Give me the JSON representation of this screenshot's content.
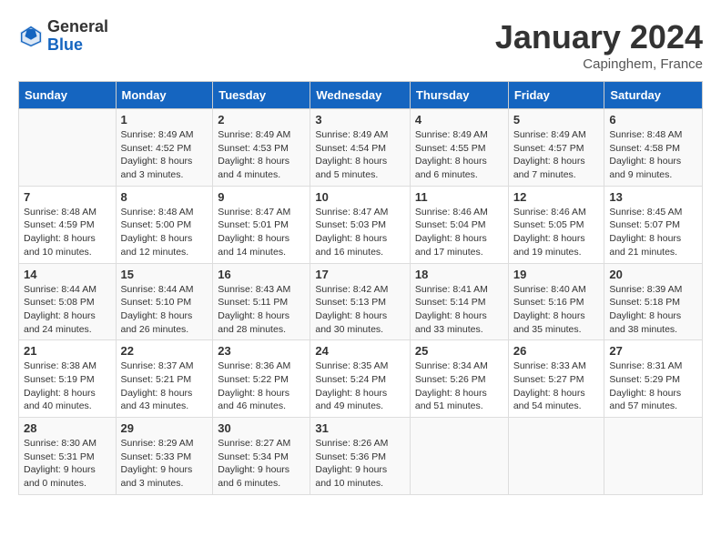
{
  "header": {
    "logo_general": "General",
    "logo_blue": "Blue",
    "month_title": "January 2024",
    "location": "Capinghem, France"
  },
  "days_of_week": [
    "Sunday",
    "Monday",
    "Tuesday",
    "Wednesday",
    "Thursday",
    "Friday",
    "Saturday"
  ],
  "weeks": [
    [
      {
        "day": "",
        "sunrise": "",
        "sunset": "",
        "daylight": ""
      },
      {
        "day": "1",
        "sunrise": "Sunrise: 8:49 AM",
        "sunset": "Sunset: 4:52 PM",
        "daylight": "Daylight: 8 hours and 3 minutes."
      },
      {
        "day": "2",
        "sunrise": "Sunrise: 8:49 AM",
        "sunset": "Sunset: 4:53 PM",
        "daylight": "Daylight: 8 hours and 4 minutes."
      },
      {
        "day": "3",
        "sunrise": "Sunrise: 8:49 AM",
        "sunset": "Sunset: 4:54 PM",
        "daylight": "Daylight: 8 hours and 5 minutes."
      },
      {
        "day": "4",
        "sunrise": "Sunrise: 8:49 AM",
        "sunset": "Sunset: 4:55 PM",
        "daylight": "Daylight: 8 hours and 6 minutes."
      },
      {
        "day": "5",
        "sunrise": "Sunrise: 8:49 AM",
        "sunset": "Sunset: 4:57 PM",
        "daylight": "Daylight: 8 hours and 7 minutes."
      },
      {
        "day": "6",
        "sunrise": "Sunrise: 8:48 AM",
        "sunset": "Sunset: 4:58 PM",
        "daylight": "Daylight: 8 hours and 9 minutes."
      }
    ],
    [
      {
        "day": "7",
        "sunrise": "Sunrise: 8:48 AM",
        "sunset": "Sunset: 4:59 PM",
        "daylight": "Daylight: 8 hours and 10 minutes."
      },
      {
        "day": "8",
        "sunrise": "Sunrise: 8:48 AM",
        "sunset": "Sunset: 5:00 PM",
        "daylight": "Daylight: 8 hours and 12 minutes."
      },
      {
        "day": "9",
        "sunrise": "Sunrise: 8:47 AM",
        "sunset": "Sunset: 5:01 PM",
        "daylight": "Daylight: 8 hours and 14 minutes."
      },
      {
        "day": "10",
        "sunrise": "Sunrise: 8:47 AM",
        "sunset": "Sunset: 5:03 PM",
        "daylight": "Daylight: 8 hours and 16 minutes."
      },
      {
        "day": "11",
        "sunrise": "Sunrise: 8:46 AM",
        "sunset": "Sunset: 5:04 PM",
        "daylight": "Daylight: 8 hours and 17 minutes."
      },
      {
        "day": "12",
        "sunrise": "Sunrise: 8:46 AM",
        "sunset": "Sunset: 5:05 PM",
        "daylight": "Daylight: 8 hours and 19 minutes."
      },
      {
        "day": "13",
        "sunrise": "Sunrise: 8:45 AM",
        "sunset": "Sunset: 5:07 PM",
        "daylight": "Daylight: 8 hours and 21 minutes."
      }
    ],
    [
      {
        "day": "14",
        "sunrise": "Sunrise: 8:44 AM",
        "sunset": "Sunset: 5:08 PM",
        "daylight": "Daylight: 8 hours and 24 minutes."
      },
      {
        "day": "15",
        "sunrise": "Sunrise: 8:44 AM",
        "sunset": "Sunset: 5:10 PM",
        "daylight": "Daylight: 8 hours and 26 minutes."
      },
      {
        "day": "16",
        "sunrise": "Sunrise: 8:43 AM",
        "sunset": "Sunset: 5:11 PM",
        "daylight": "Daylight: 8 hours and 28 minutes."
      },
      {
        "day": "17",
        "sunrise": "Sunrise: 8:42 AM",
        "sunset": "Sunset: 5:13 PM",
        "daylight": "Daylight: 8 hours and 30 minutes."
      },
      {
        "day": "18",
        "sunrise": "Sunrise: 8:41 AM",
        "sunset": "Sunset: 5:14 PM",
        "daylight": "Daylight: 8 hours and 33 minutes."
      },
      {
        "day": "19",
        "sunrise": "Sunrise: 8:40 AM",
        "sunset": "Sunset: 5:16 PM",
        "daylight": "Daylight: 8 hours and 35 minutes."
      },
      {
        "day": "20",
        "sunrise": "Sunrise: 8:39 AM",
        "sunset": "Sunset: 5:18 PM",
        "daylight": "Daylight: 8 hours and 38 minutes."
      }
    ],
    [
      {
        "day": "21",
        "sunrise": "Sunrise: 8:38 AM",
        "sunset": "Sunset: 5:19 PM",
        "daylight": "Daylight: 8 hours and 40 minutes."
      },
      {
        "day": "22",
        "sunrise": "Sunrise: 8:37 AM",
        "sunset": "Sunset: 5:21 PM",
        "daylight": "Daylight: 8 hours and 43 minutes."
      },
      {
        "day": "23",
        "sunrise": "Sunrise: 8:36 AM",
        "sunset": "Sunset: 5:22 PM",
        "daylight": "Daylight: 8 hours and 46 minutes."
      },
      {
        "day": "24",
        "sunrise": "Sunrise: 8:35 AM",
        "sunset": "Sunset: 5:24 PM",
        "daylight": "Daylight: 8 hours and 49 minutes."
      },
      {
        "day": "25",
        "sunrise": "Sunrise: 8:34 AM",
        "sunset": "Sunset: 5:26 PM",
        "daylight": "Daylight: 8 hours and 51 minutes."
      },
      {
        "day": "26",
        "sunrise": "Sunrise: 8:33 AM",
        "sunset": "Sunset: 5:27 PM",
        "daylight": "Daylight: 8 hours and 54 minutes."
      },
      {
        "day": "27",
        "sunrise": "Sunrise: 8:31 AM",
        "sunset": "Sunset: 5:29 PM",
        "daylight": "Daylight: 8 hours and 57 minutes."
      }
    ],
    [
      {
        "day": "28",
        "sunrise": "Sunrise: 8:30 AM",
        "sunset": "Sunset: 5:31 PM",
        "daylight": "Daylight: 9 hours and 0 minutes."
      },
      {
        "day": "29",
        "sunrise": "Sunrise: 8:29 AM",
        "sunset": "Sunset: 5:33 PM",
        "daylight": "Daylight: 9 hours and 3 minutes."
      },
      {
        "day": "30",
        "sunrise": "Sunrise: 8:27 AM",
        "sunset": "Sunset: 5:34 PM",
        "daylight": "Daylight: 9 hours and 6 minutes."
      },
      {
        "day": "31",
        "sunrise": "Sunrise: 8:26 AM",
        "sunset": "Sunset: 5:36 PM",
        "daylight": "Daylight: 9 hours and 10 minutes."
      },
      {
        "day": "",
        "sunrise": "",
        "sunset": "",
        "daylight": ""
      },
      {
        "day": "",
        "sunrise": "",
        "sunset": "",
        "daylight": ""
      },
      {
        "day": "",
        "sunrise": "",
        "sunset": "",
        "daylight": ""
      }
    ]
  ]
}
